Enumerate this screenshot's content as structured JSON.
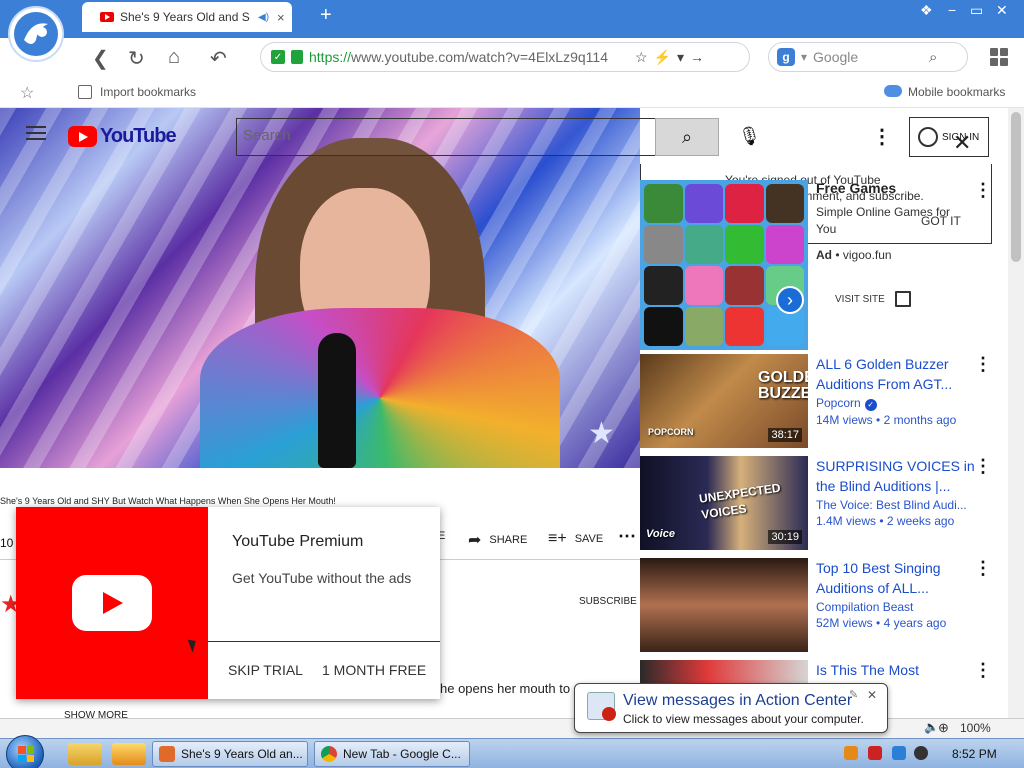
{
  "browser": {
    "tab": {
      "title": "She's 9 Years Old and S",
      "close": "×"
    },
    "new_tab": "+",
    "window_controls": {
      "minimize": "−",
      "maximize": "▭",
      "close": "✕",
      "extra": "❖"
    },
    "url": {
      "secure": "https://",
      "host": "www.youtube.com",
      "path": "/watch?v=4ElxLz9q114"
    },
    "search_engine_placeholder": "Google",
    "bookmarks": {
      "import": "Import bookmarks",
      "mobile": "Mobile bookmarks"
    }
  },
  "youtube": {
    "logo_text": "YouTube",
    "search_placeholder": "Search",
    "sign_in": "SIGN IN",
    "signin_tip": {
      "line1": "You're signed out of YouTube",
      "line2": "deos, comment, and subscribe.",
      "got_it": "GOT IT"
    },
    "video": {
      "title": "She's 9 Years Old and SHY But Watch What Happens When She Opens Her Mouth!",
      "views_fragment": "10",
      "share": "SHARE",
      "save": "SAVE",
      "share_prefix": "E",
      "subscribe": "SUBSCRIBE",
      "description_fragment": "he opens her mouth to",
      "show_more": "SHOW MORE"
    },
    "ad": {
      "title": "Free Games",
      "description": "Simple Online Games for You",
      "label": "Ad",
      "domain": "vigoo.fun",
      "visit_site": "VISIT SITE"
    },
    "sidebar": [
      {
        "title": "ALL 6 Golden Buzzer Auditions From AGT...",
        "channel": "Popcorn",
        "verified": true,
        "views": "14M views",
        "age": "2 months ago",
        "duration": "38:17",
        "overlay": "GOLDEN BUZZERS",
        "badge": "POPCORN"
      },
      {
        "title": "SURPRISING VOICES in the Blind Auditions |...",
        "channel": "The Voice: Best Blind Audi...",
        "verified": false,
        "views": "1.4M views",
        "age": "2 weeks ago",
        "duration": "30:19",
        "overlay": "UNEXPECTED VOICES",
        "badge": "Voice"
      },
      {
        "title": "Top 10 Best Singing Auditions of ALL...",
        "channel": "Compilation Beast",
        "verified": false,
        "views": "52M views",
        "age": "4 years ago",
        "duration": "",
        "overlay": "",
        "badge": ""
      },
      {
        "title": "Is This The Most ...male...",
        "channel": "",
        "verified": false,
        "views": "",
        "age": "",
        "duration": "",
        "overlay": "",
        "badge": ""
      }
    ],
    "premium": {
      "title": "YouTube Premium",
      "subtitle": "Get YouTube without the ads",
      "skip": "SKIP TRIAL",
      "cta": "1 MONTH FREE"
    }
  },
  "status": {
    "zoom": "100%"
  },
  "balloon": {
    "title": "View messages in Action Center",
    "text": "Click to view messages about your computer."
  },
  "taskbar": {
    "tasks": [
      {
        "label": "She's 9 Years Old an..."
      },
      {
        "label": "New Tab - Google C..."
      }
    ],
    "time": "8:52 PM"
  },
  "colors": {
    "yt_red": "#ff0000",
    "link_blue": "#1a4dcc",
    "browser_blue": "#3c7fd6"
  }
}
